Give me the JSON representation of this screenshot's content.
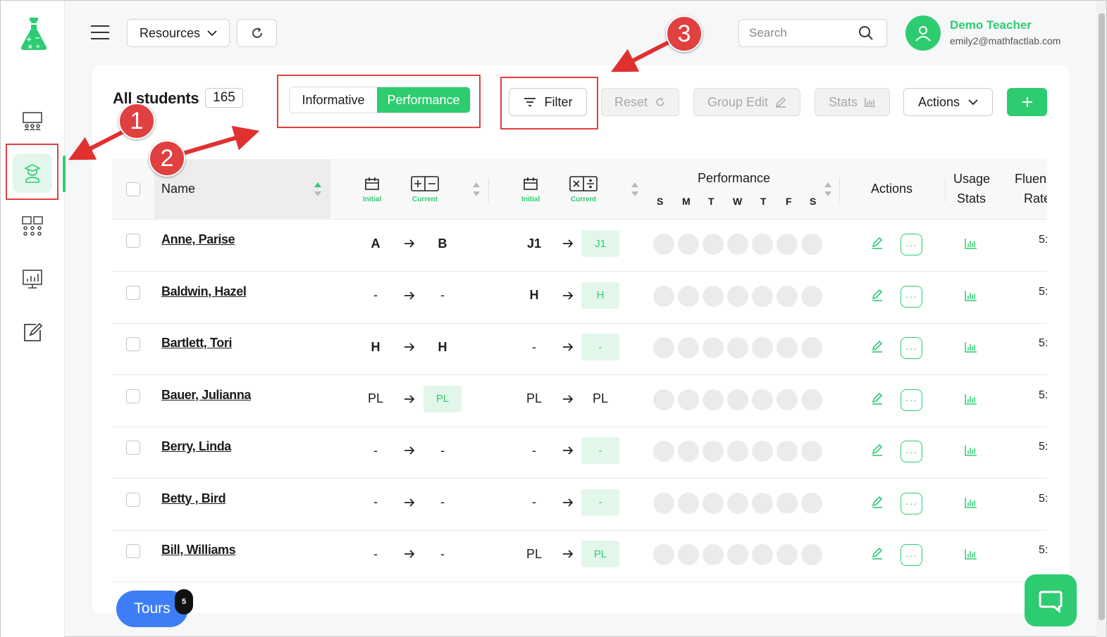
{
  "sidebar": {
    "items": [
      {
        "name": "classroom-icon"
      },
      {
        "name": "student-icon",
        "active": true
      },
      {
        "name": "groups-icon"
      },
      {
        "name": "reports-icon"
      },
      {
        "name": "assignments-icon"
      }
    ]
  },
  "topbar": {
    "resources_label": "Resources",
    "search_placeholder": "Search",
    "user_name": "Demo Teacher",
    "user_email": "emily2@mathfactlab.com"
  },
  "toolbar": {
    "title": "All students",
    "count": "165",
    "toggle_informative": "Informative",
    "toggle_performance": "Performance",
    "filter_label": "Filter",
    "reset_label": "Reset",
    "group_edit_label": "Group Edit",
    "stats_label": "Stats",
    "actions_label": "Actions",
    "add_label": "+"
  },
  "table": {
    "headers": {
      "name": "Name",
      "initial": "Initial",
      "current": "Current",
      "performance": "Performance",
      "actions": "Actions",
      "usage_line1": "Usage",
      "usage_line2": "Stats",
      "fluency_line1": "Fluen",
      "fluency_line2": "Rate"
    },
    "days": [
      "S",
      "M",
      "T",
      "W",
      "T",
      "F",
      "S"
    ],
    "rows": [
      {
        "name": "Anne, Parise",
        "as_initial": "A",
        "as_current": "B",
        "md_initial": "J1",
        "md_current": "J1",
        "fluency": "5:"
      },
      {
        "name": "Baldwin, Hazel",
        "as_initial": "-",
        "as_current": "-",
        "md_initial": "H",
        "md_current": "H",
        "fluency": "5:"
      },
      {
        "name": "Bartlett, Tori",
        "as_initial": "H",
        "as_current": "H",
        "md_initial": "-",
        "md_current": "-",
        "fluency": "5:"
      },
      {
        "name": "Bauer, Julianna",
        "as_initial": "PL",
        "as_current": "PL",
        "md_initial": "PL",
        "md_current": "PL",
        "fluency": "5:"
      },
      {
        "name": "Berry, Linda",
        "as_initial": "-",
        "as_current": "-",
        "md_initial": "-",
        "md_current": "-",
        "fluency": "5:"
      },
      {
        "name": "Betty , Bird",
        "as_initial": "-",
        "as_current": "-",
        "md_initial": "-",
        "md_current": "-",
        "fluency": "5:"
      },
      {
        "name": "Bill, Williams",
        "as_initial": "-",
        "as_current": "-",
        "md_initial": "PL",
        "md_current": "PL",
        "fluency": "5:"
      }
    ]
  },
  "footer": {
    "tours_label": "Tours",
    "tours_badge": "5"
  },
  "callouts": [
    "1",
    "2",
    "3"
  ],
  "colors": {
    "brand_green": "#2ecc71",
    "tours_blue": "#3d7ef6",
    "annotation_red": "#e04040"
  }
}
